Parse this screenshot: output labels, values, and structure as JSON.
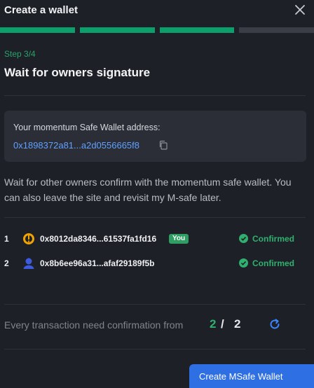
{
  "header": {
    "title": "Create a wallet",
    "close_icon": "close-icon"
  },
  "progress": {
    "current_step": 3,
    "total_steps": 4,
    "active_color": "#0d9f6b",
    "inactive_color": "#3a3d46"
  },
  "step_label": "Step 3/4",
  "heading": "Wait for owners signature",
  "address_card": {
    "label": "Your momentum Safe Wallet address:",
    "address": "0x1898372a81...a2d0556665f8",
    "copy_icon": "copy-icon"
  },
  "description": "Wait for other owners confirm with the momentum safe wallet. You can also leave the site and revisit my M-safe later.",
  "owners": [
    {
      "index": "1",
      "address": "0x8012da8346...61537fa1fd16",
      "badge": "You",
      "status": "Confirmed",
      "avatar_icon": "avatar-exclaim-icon"
    },
    {
      "index": "2",
      "address": "0x8b6ee96a31...afaf29189f5b",
      "badge": "",
      "status": "Confirmed",
      "avatar_icon": "avatar-person-icon"
    }
  ],
  "confirmation": {
    "text": "Every transaction need confirmation from",
    "current": "2",
    "separator": "/",
    "total": "2",
    "refresh_icon": "refresh-icon"
  },
  "create_button": {
    "label": "Create MSafe Wallet"
  },
  "colors": {
    "accent_green": "#2fb06f",
    "link_blue": "#5fa0ff",
    "button_blue": "#2f6fe4",
    "background": "#1e2027"
  }
}
